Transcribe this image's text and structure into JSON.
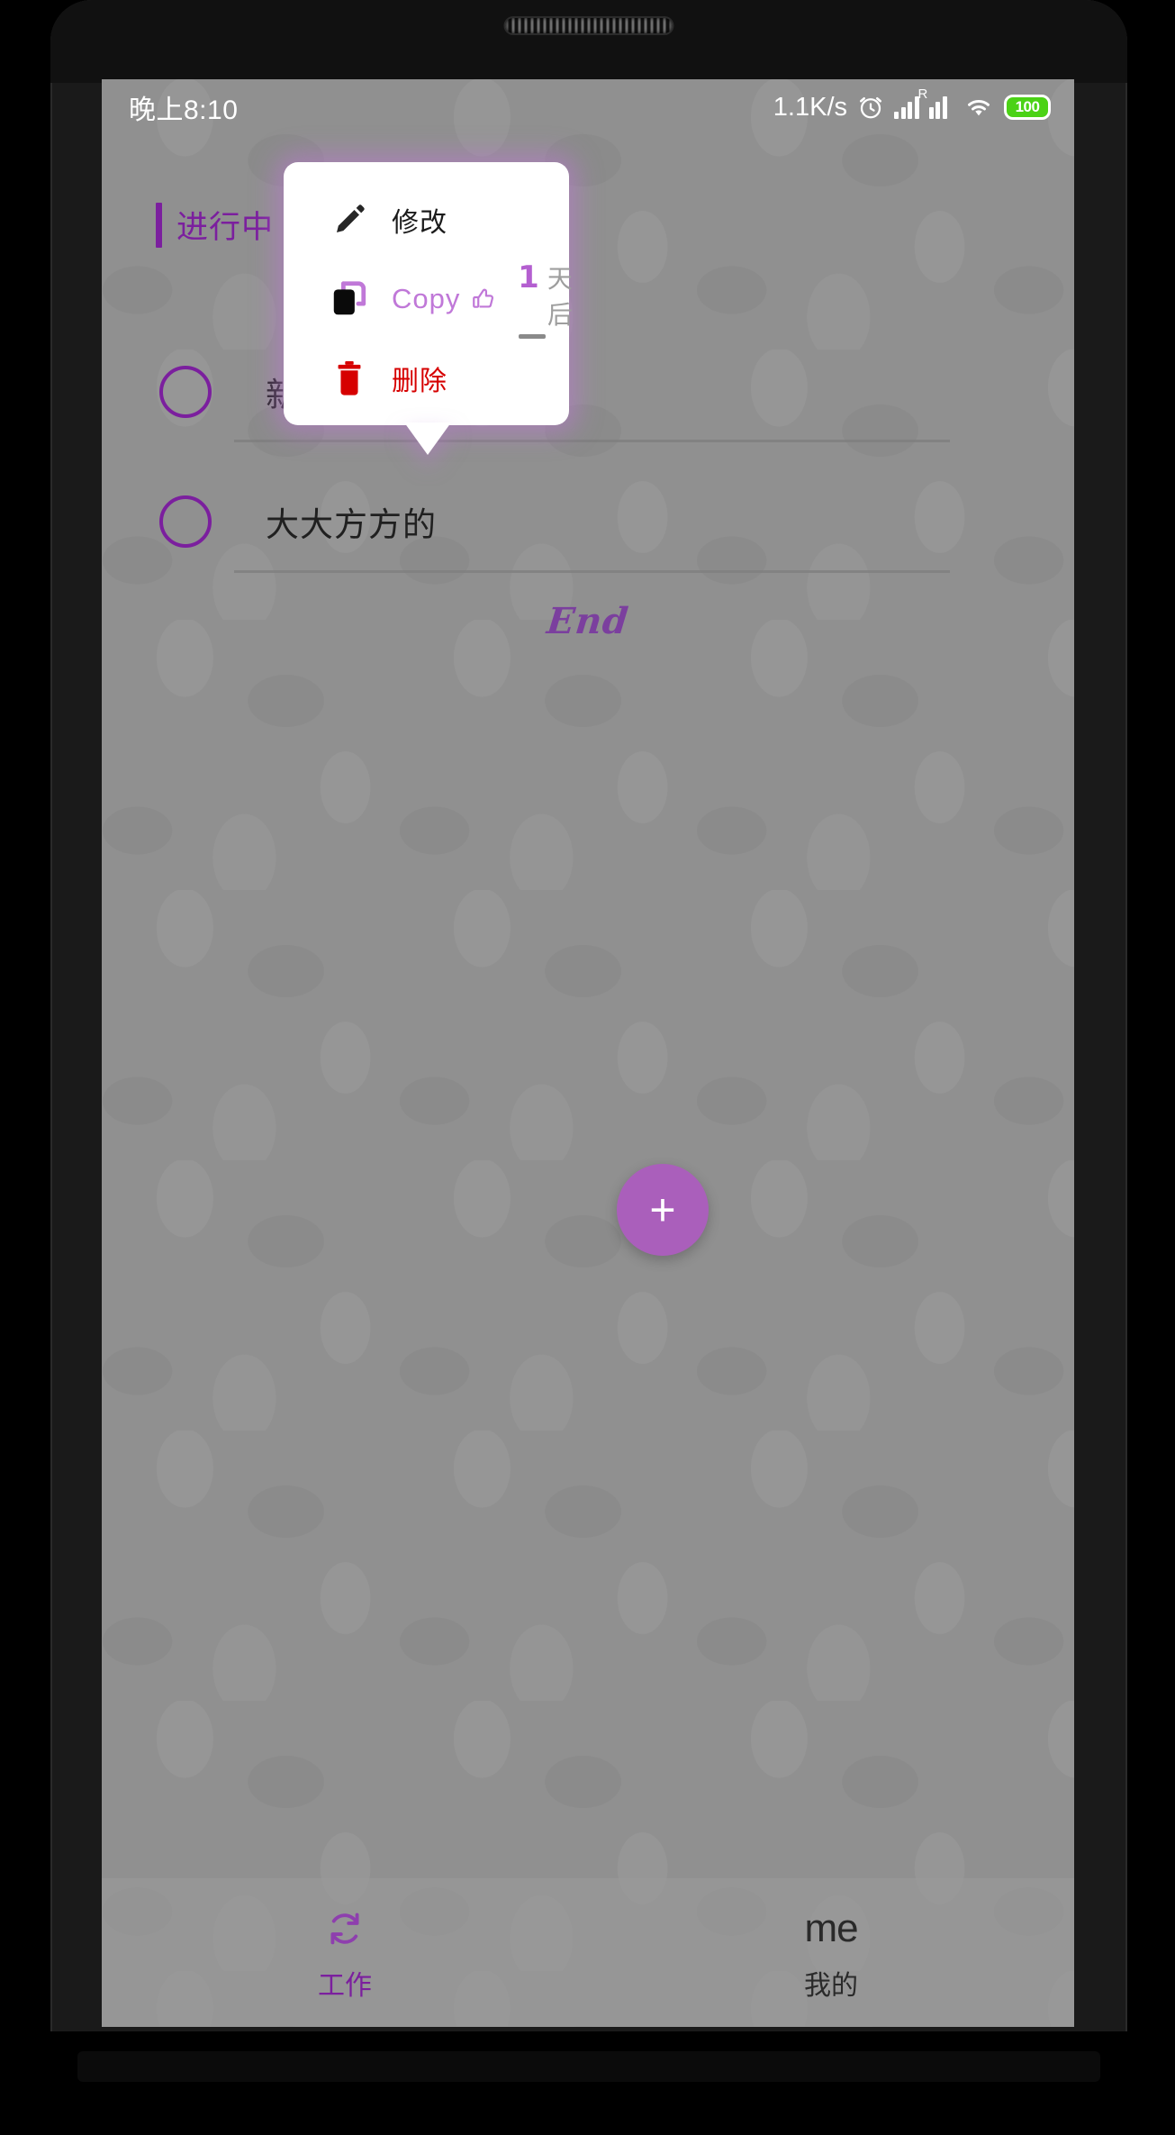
{
  "statusbar": {
    "time": "晚上8:10",
    "network_speed": "1.1K/s",
    "alarm_icon": "alarm-clock-icon",
    "signal_icon": "signal-bars-icon",
    "signal_roaming_icon": "signal-roaming-icon",
    "roaming_label": "R",
    "wifi_icon": "wifi-icon",
    "battery_level": "100",
    "battery_color": "#4bd216"
  },
  "section": {
    "title": "进行中",
    "accent_color": "#7b1f9e"
  },
  "tasks": [
    {
      "text": "新的地",
      "checkbox": "unchecked"
    },
    {
      "text": "大大方方的",
      "checkbox": "unchecked"
    }
  ],
  "end_marker": "End",
  "popup_menu": {
    "items": [
      {
        "label": "修改",
        "icon": "pencil-icon",
        "color": "#1b1b1b"
      },
      {
        "label": "Copy",
        "icon": "copy-icon",
        "color": "#c078d8",
        "thumb_icon": "thumbs-up-icon",
        "day_number": "1",
        "day_unit": "天后"
      },
      {
        "label": "删除",
        "icon": "trash-icon",
        "color": "#d60000"
      }
    ]
  },
  "fab": {
    "label": "+",
    "icon": "plus-icon",
    "color": "#aa5fbb"
  },
  "bottom_nav": {
    "items": [
      {
        "label": "工作",
        "icon": "sync-refresh-icon",
        "active": true
      },
      {
        "label": "我的",
        "icon": "me-logo",
        "logo_text": "me",
        "active": false
      }
    ]
  }
}
